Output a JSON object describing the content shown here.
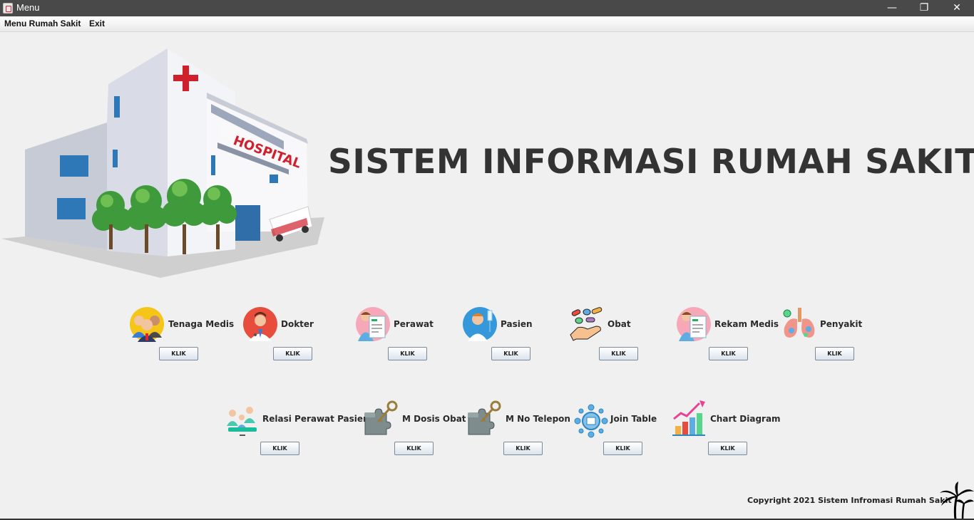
{
  "window": {
    "title": "Menu",
    "minimize": "—",
    "maximize": "❐",
    "close": "✕"
  },
  "menubar": {
    "items": [
      "Menu Rumah Sakit",
      "Exit"
    ]
  },
  "illustration": {
    "sign_text": "HOSPITAL"
  },
  "main_title": "SISTEM INFORMASI RUMAH SAKIT",
  "button_label": "KLIK",
  "row1": [
    {
      "label": "Tenaga Medis",
      "icon": "medical-staff-icon"
    },
    {
      "label": "Dokter",
      "icon": "doctor-icon"
    },
    {
      "label": "Perawat",
      "icon": "nurse-icon"
    },
    {
      "label": "Pasien",
      "icon": "patient-icon"
    },
    {
      "label": "Obat",
      "icon": "medicine-icon"
    },
    {
      "label": "Rekam Medis",
      "icon": "medical-record-icon"
    },
    {
      "label": "Penyakit",
      "icon": "disease-lungs-icon"
    }
  ],
  "row2": [
    {
      "label": "Relasi Perawat Pasien",
      "icon": "nurse-patient-relation-icon"
    },
    {
      "label": "M Dosis Obat",
      "icon": "puzzle-key-icon"
    },
    {
      "label": "M No Telepon",
      "icon": "puzzle-key-icon"
    },
    {
      "label": "Join Table",
      "icon": "network-join-icon"
    },
    {
      "label": "Chart Diagram",
      "icon": "bar-chart-icon"
    }
  ],
  "footer": {
    "copyright": "Copyright 2021 Sistem Infromasi Rumah Sakit"
  },
  "colors": {
    "titlebar": "#494949",
    "background": "#f0f0f0",
    "heading": "#333333",
    "hospital_red": "#d0202e"
  }
}
